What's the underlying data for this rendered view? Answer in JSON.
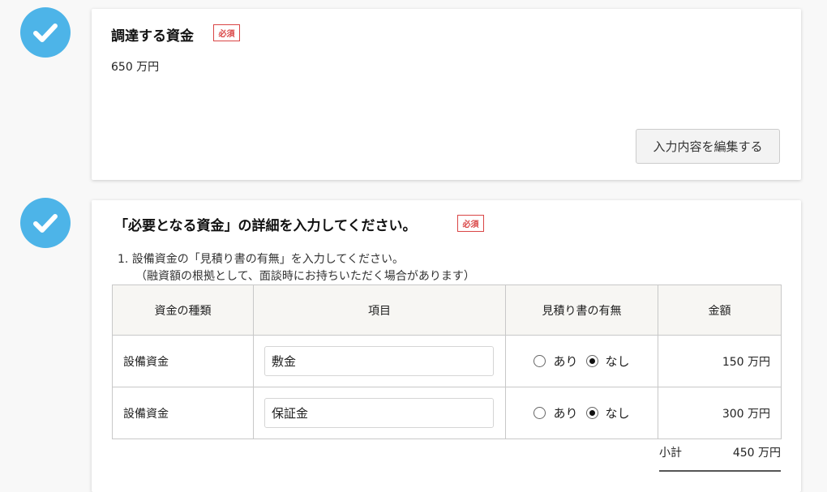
{
  "section1": {
    "title": "調達する資金",
    "required_badge": "必須",
    "amount_text": "650 万円",
    "edit_button_label": "入力内容を編集する"
  },
  "section2": {
    "title": "「必要となる資金」の詳細を入力してください。",
    "required_badge": "必須",
    "instruction_line1": "1. 設備資金の「見積り書の有無」を入力してください。",
    "instruction_line2": "（融資額の根拠として、面談時にお持ちいただく場合があります）",
    "table": {
      "headers": [
        "資金の種類",
        "項目",
        "見積り書の有無",
        "金額"
      ],
      "rows": [
        {
          "type": "設備資金",
          "item": "敷金",
          "option_yes": "あり",
          "option_no": "なし",
          "selected": "なし",
          "amount": "150 万円"
        },
        {
          "type": "設備資金",
          "item": "保証金",
          "option_yes": "あり",
          "option_no": "なし",
          "selected": "なし",
          "amount": "300 万円"
        }
      ]
    },
    "subtotal_label": "小計",
    "subtotal_value": "450 万円"
  },
  "icons": {
    "step_complete": "checkmark-circle-icon"
  },
  "colors": {
    "check_circle": "#4db4e8",
    "required_badge": "#d94545"
  }
}
